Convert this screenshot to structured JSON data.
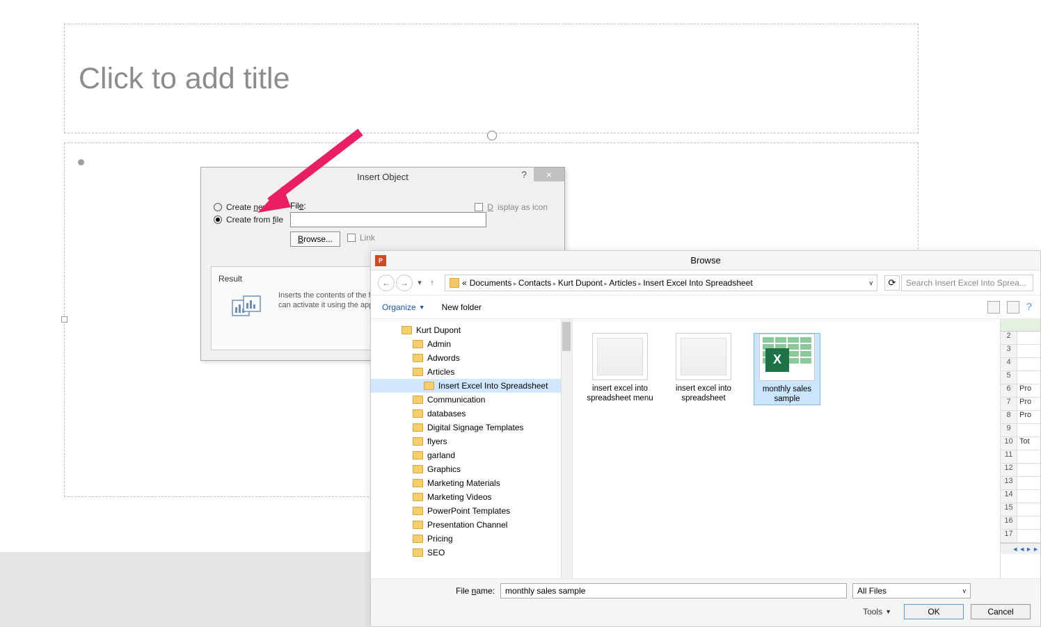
{
  "slide": {
    "title_placeholder": "Click to add title"
  },
  "insert_object": {
    "title": "Insert Object",
    "radio_create_new": "Create new",
    "radio_create_file": "Create from file",
    "file_label": "File:",
    "browse": "Browse...",
    "link": "Link",
    "display_icon": "Display as icon",
    "result_label": "Result",
    "result_text": "Inserts the contents of the file as an object into your presentation so that you can activate it using the application that created it."
  },
  "browse": {
    "title": "Browse",
    "crumbs": [
      "Documents",
      "Contacts",
      "Kurt Dupont",
      "Articles",
      "Insert Excel Into Spreadsheet"
    ],
    "search_placeholder": "Search Insert Excel Into Sprea...",
    "organize": "Organize",
    "new_folder": "New folder",
    "tree": [
      {
        "label": "Kurt Dupont",
        "indent": 1
      },
      {
        "label": "Admin",
        "indent": 2
      },
      {
        "label": "Adwords",
        "indent": 2
      },
      {
        "label": "Articles",
        "indent": 2
      },
      {
        "label": "Insert Excel Into Spreadsheet",
        "indent": 3,
        "sel": true
      },
      {
        "label": "Communication",
        "indent": 2
      },
      {
        "label": "databases",
        "indent": 2
      },
      {
        "label": "Digital Signage Templates",
        "indent": 2
      },
      {
        "label": "flyers",
        "indent": 2
      },
      {
        "label": "garland",
        "indent": 2
      },
      {
        "label": "Graphics",
        "indent": 2
      },
      {
        "label": "Marketing Materials",
        "indent": 2
      },
      {
        "label": "Marketing Videos",
        "indent": 2
      },
      {
        "label": "PowerPoint Templates",
        "indent": 2
      },
      {
        "label": "Presentation Channel",
        "indent": 2
      },
      {
        "label": "Pricing",
        "indent": 2
      },
      {
        "label": "SEO",
        "indent": 2
      }
    ],
    "files": [
      {
        "name": "insert excel into spreadsheet menu"
      },
      {
        "name": "insert excel into spreadsheet"
      },
      {
        "name": "monthly sales sample",
        "sel": true,
        "excel": true
      }
    ],
    "sheet_rows": [
      {
        "n": "2",
        "v": ""
      },
      {
        "n": "3",
        "v": ""
      },
      {
        "n": "4",
        "v": ""
      },
      {
        "n": "5",
        "v": ""
      },
      {
        "n": "6",
        "v": "Pro"
      },
      {
        "n": "7",
        "v": "Pro"
      },
      {
        "n": "8",
        "v": "Pro"
      },
      {
        "n": "9",
        "v": ""
      },
      {
        "n": "10",
        "v": "Tot"
      },
      {
        "n": "11",
        "v": ""
      },
      {
        "n": "12",
        "v": ""
      },
      {
        "n": "13",
        "v": ""
      },
      {
        "n": "14",
        "v": ""
      },
      {
        "n": "15",
        "v": ""
      },
      {
        "n": "16",
        "v": ""
      },
      {
        "n": "17",
        "v": ""
      }
    ],
    "file_name_label": "File name:",
    "file_name_value": "monthly sales sample",
    "filter": "All Files",
    "tools": "Tools",
    "ok": "OK",
    "cancel": "Cancel"
  }
}
